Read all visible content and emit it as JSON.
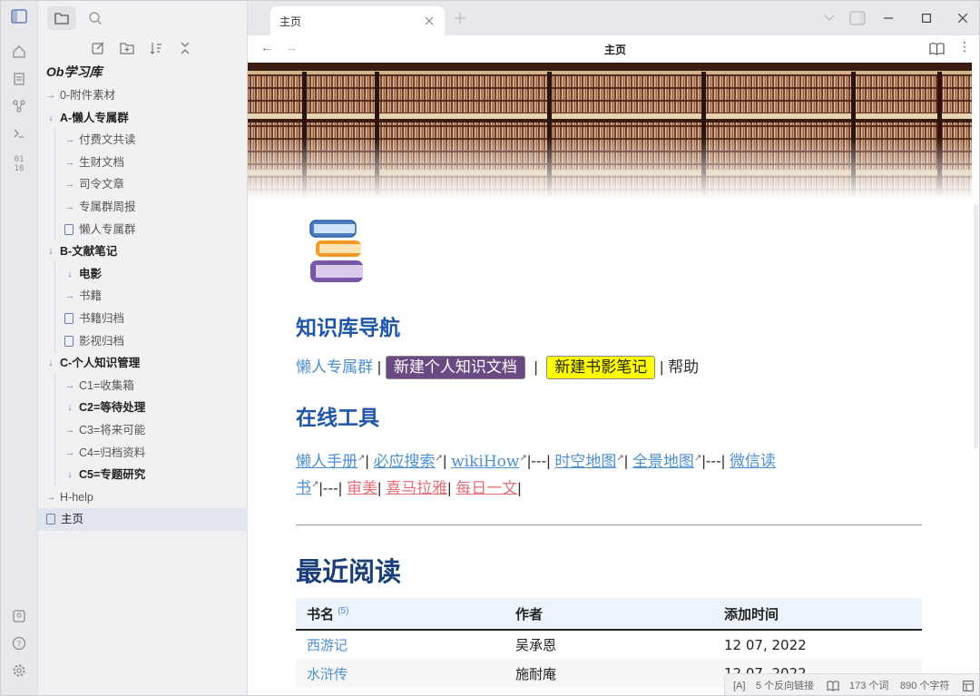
{
  "tab": {
    "title": "主页"
  },
  "nav": {
    "title": "主页"
  },
  "sidebar": {
    "vault_name": "Ob学习库",
    "items": [
      {
        "label": "0-附件素材"
      },
      {
        "label": "A-懒人专属群"
      },
      {
        "label": "付费文共读"
      },
      {
        "label": "生财文档"
      },
      {
        "label": "司令文章"
      },
      {
        "label": "专属群周报"
      },
      {
        "label": "懒人专属群"
      },
      {
        "label": "B-文献笔记"
      },
      {
        "label": "电影"
      },
      {
        "label": "书籍"
      },
      {
        "label": "书籍归档"
      },
      {
        "label": "影视归档"
      },
      {
        "label": "C-个人知识管理"
      },
      {
        "label": "C1=收集箱"
      },
      {
        "label": "C2=等待处理"
      },
      {
        "label": "C3=将来可能"
      },
      {
        "label": "C4=归档资料"
      },
      {
        "label": "C5=专题研究"
      },
      {
        "label": "H-help"
      },
      {
        "label": "主页"
      }
    ]
  },
  "doc": {
    "nav_heading": "知识库导航",
    "nav_links": {
      "l1": "懒人专属群",
      "l2": "新建个人知识文档",
      "l3": "新建书影笔记",
      "l4": "帮助",
      "sep": "|"
    },
    "tools_heading": "在线工具",
    "tools": {
      "t1": "懒人手册",
      "t2": "必应搜索",
      "t3": "wikiHow",
      "t4": "时空地图",
      "t5": "全景地图",
      "t6a": "微信读",
      "t6b": "书",
      "t7": "审美",
      "t8": "喜马拉雅",
      "t9": "每日一文",
      "sep1": "|",
      "sep2": "|---|",
      "sep3": "|"
    },
    "recent_heading": "最近阅读",
    "table": {
      "headers": {
        "name": "书名",
        "count": "(5)",
        "author": "作者",
        "added": "添加时间"
      },
      "rows": [
        {
          "name": "西游记",
          "author": "吴承恩",
          "added": "12 07, 2022"
        },
        {
          "name": "水浒传",
          "author": "施耐庵",
          "added": "12 07, 2022"
        }
      ]
    }
  },
  "status": {
    "mode": "[A]",
    "backlinks": "5 个反向链接",
    "words": "173 个词",
    "chars": "890 个字符"
  },
  "colors": {
    "heading": "#1f56a8",
    "link": "#4d8fd0",
    "tag_purple": "#6b4a83",
    "tag_yellow": "#ffff00",
    "link_red": "#e36f78"
  }
}
